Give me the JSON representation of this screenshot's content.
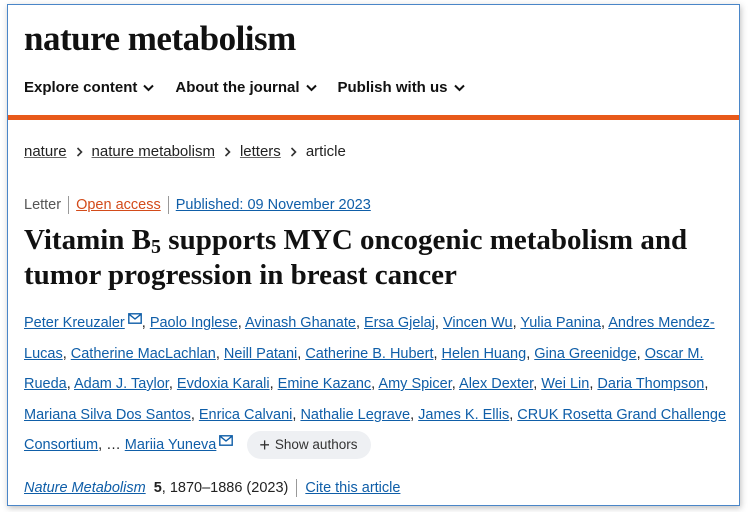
{
  "brand": {
    "name": "nature metabolism"
  },
  "nav": {
    "items": [
      {
        "label": "Explore content"
      },
      {
        "label": "About the journal"
      },
      {
        "label": "Publish with us"
      }
    ]
  },
  "breadcrumb": {
    "items": [
      "nature",
      "nature metabolism",
      "letters"
    ],
    "current": "article"
  },
  "article": {
    "type": "Letter",
    "access": "Open access",
    "published": "Published: 09 November 2023",
    "title_part1": "Vitamin B",
    "title_sub": "5",
    "title_part2": " supports MYC oncogenic metabolism and tumor progression in breast cancer"
  },
  "authors": {
    "names": [
      "Peter Kreuzaler",
      "Paolo Inglese",
      "Avinash Ghanate",
      "Ersa Gjelaj",
      "Vincen Wu",
      "Yulia Panina",
      "Andres Mendez-Lucas",
      "Catherine MacLachlan",
      "Neill Patani",
      "Catherine B. Hubert",
      "Helen Huang",
      "Gina Greenidge",
      "Oscar M. Rueda",
      "Adam J. Taylor",
      "Evdoxia Karali",
      "Emine Kazanc",
      "Amy Spicer",
      "Alex Dexter",
      "Wei Lin",
      "Daria Thompson",
      "Mariana Silva Dos Santos",
      "Enrica Calvani",
      "Nathalie Legrave",
      "James K. Ellis",
      "CRUK Rosetta Grand Challenge Consortium"
    ],
    "ellipsis": "…",
    "last_author": "Mariia Yuneva",
    "show_authors_label": "Show authors"
  },
  "citation": {
    "journal": "Nature Metabolism",
    "volume": "5",
    "pages_year": ", 1870–1886 (2023)",
    "cite_label": "Cite this article"
  }
}
